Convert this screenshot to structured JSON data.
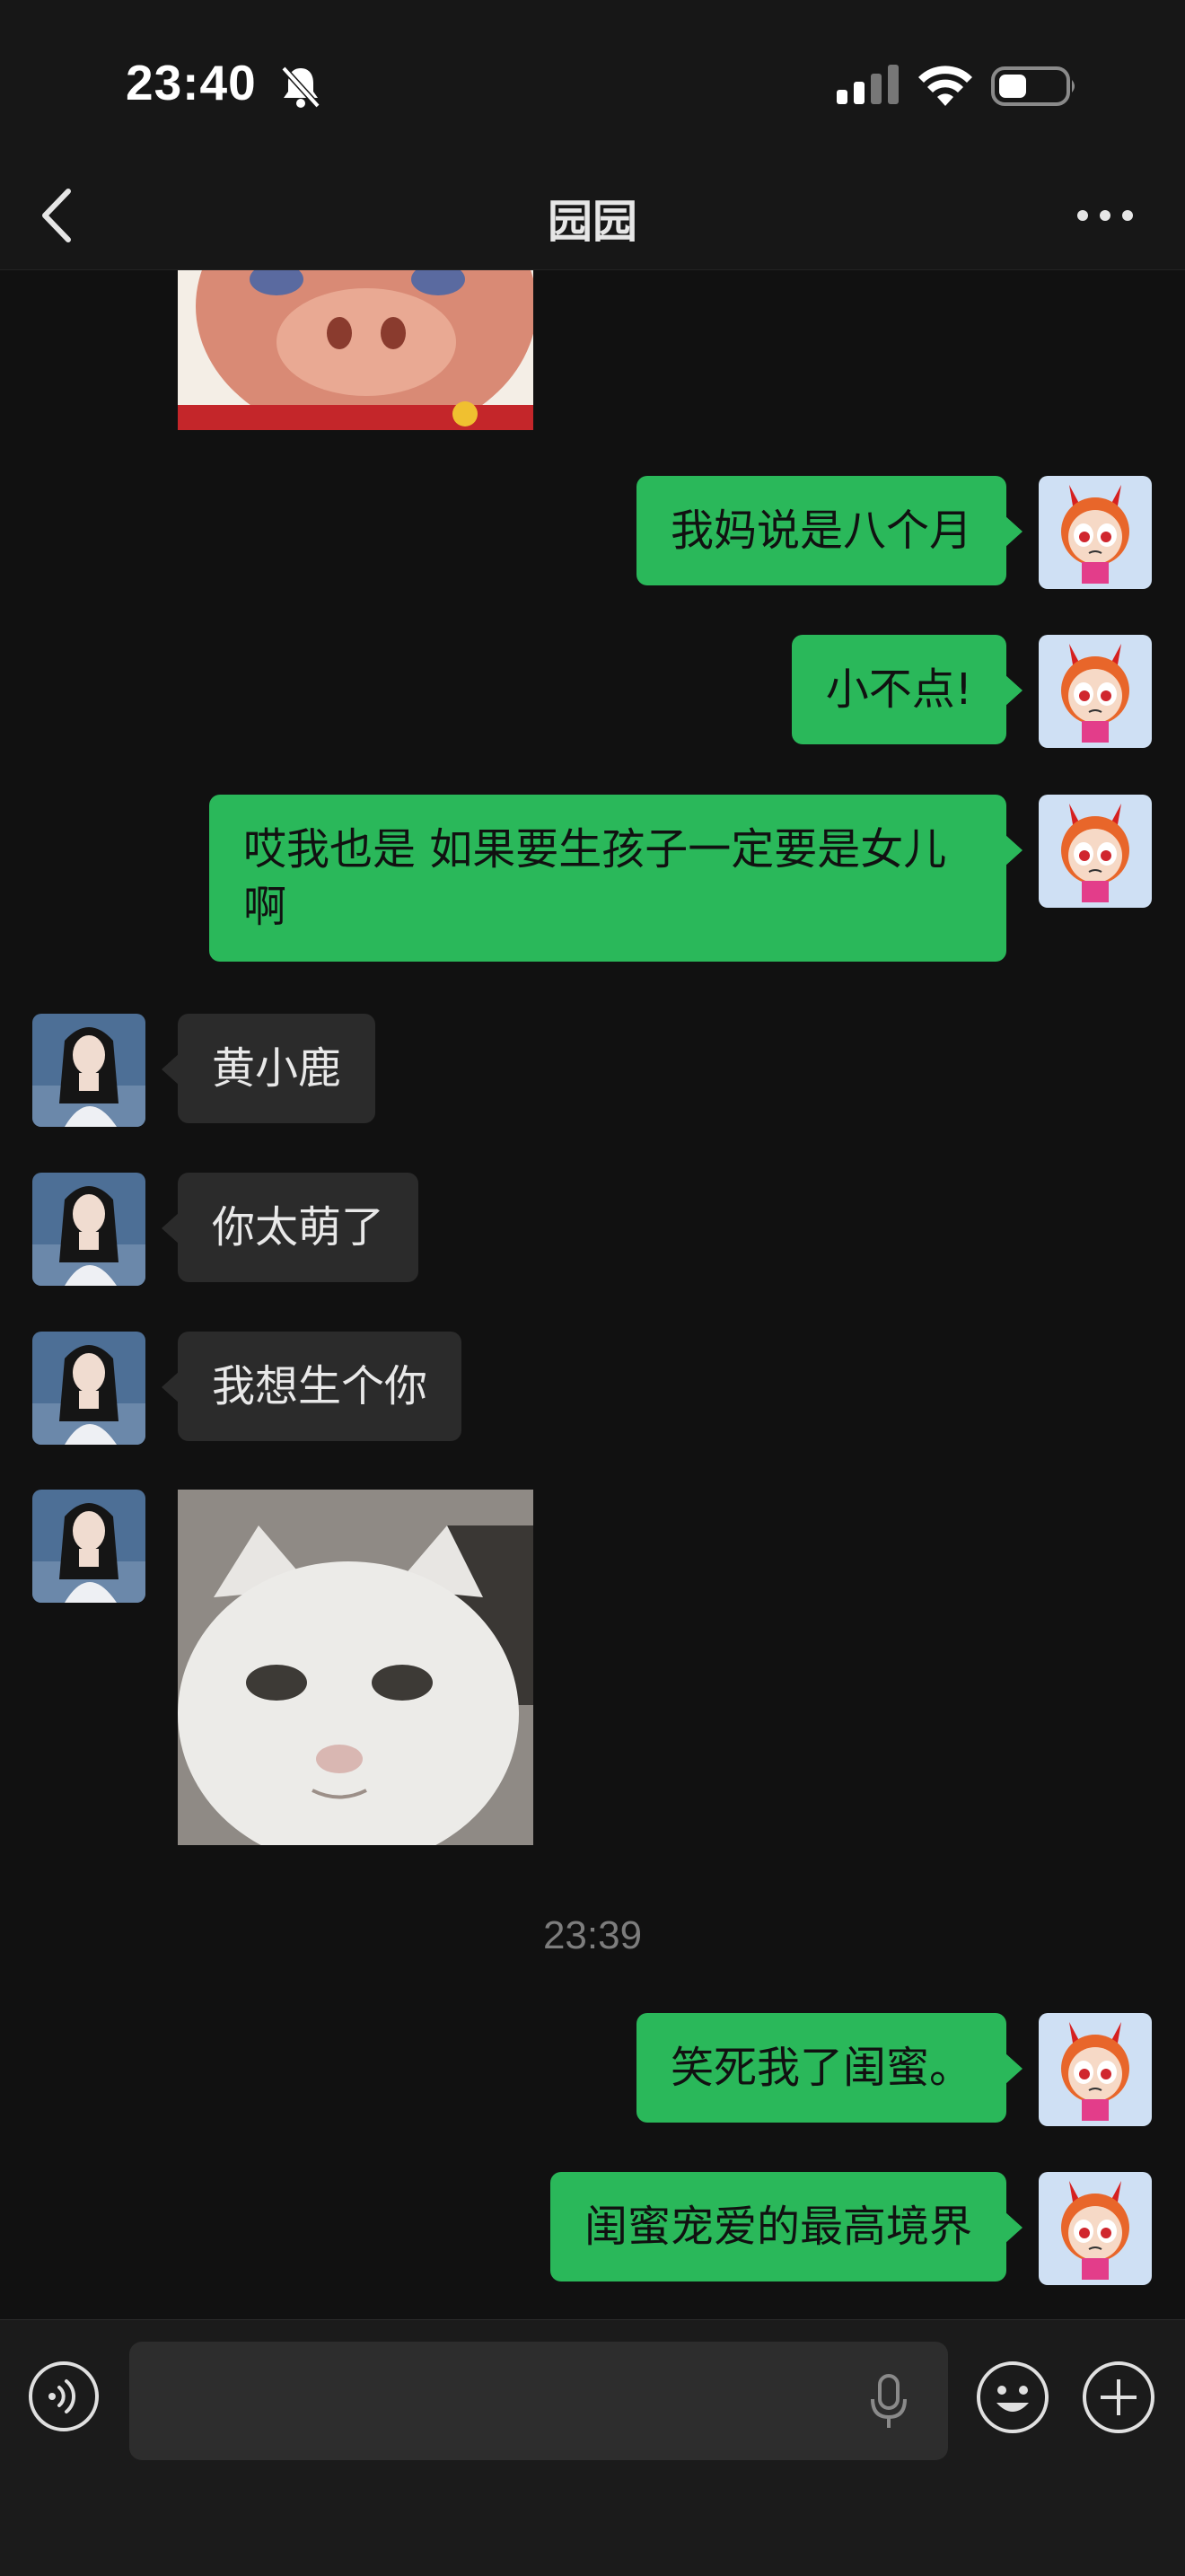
{
  "status_bar": {
    "time": "23:40",
    "icons": [
      "bell-muted-icon",
      "signal-icon",
      "wifi-icon",
      "battery-icon"
    ]
  },
  "nav": {
    "title": "园园",
    "icons": [
      "back-chevron-icon",
      "more-dots-icon"
    ]
  },
  "messages": [
    {
      "from": "them",
      "type": "image",
      "content": "pig-sticker"
    },
    {
      "from": "me",
      "type": "text",
      "text": "我妈说是八个月"
    },
    {
      "from": "me",
      "type": "text",
      "text": "小不点!"
    },
    {
      "from": "me",
      "type": "text",
      "text": "哎我也是 如果要生孩子一定要是女儿啊"
    },
    {
      "from": "them",
      "type": "text",
      "text": "黄小鹿"
    },
    {
      "from": "them",
      "type": "text",
      "text": "你太萌了"
    },
    {
      "from": "them",
      "type": "text",
      "text": "我想生个你"
    },
    {
      "from": "them",
      "type": "image",
      "content": "white-cat-sticker"
    },
    {
      "type": "timestamp",
      "text": "23:39"
    },
    {
      "from": "me",
      "type": "text",
      "text": "笑死我了闺蜜。"
    },
    {
      "from": "me",
      "type": "text",
      "text": "闺蜜宠爱的最高境界"
    }
  ],
  "input_bar": {
    "value": "",
    "icons": [
      "voice-icon",
      "mic-icon",
      "emoji-icon",
      "plus-icon"
    ]
  },
  "colors": {
    "background": "#111111",
    "my_bubble": "#2ab85a",
    "their_bubble": "#2b2b2b",
    "timestamp_text": "#7d7d7d"
  }
}
